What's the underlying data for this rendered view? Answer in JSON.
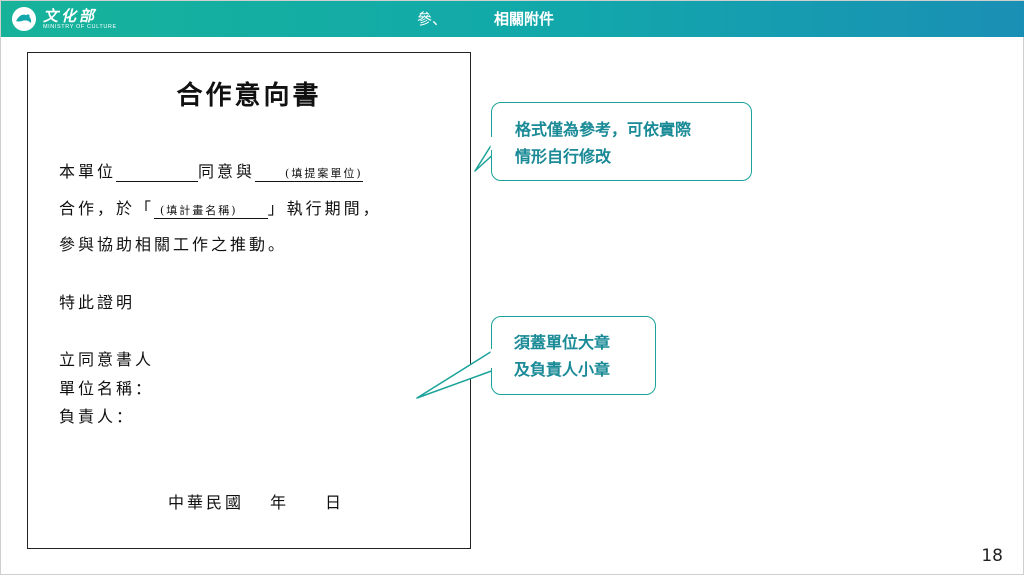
{
  "header": {
    "logo_text": "文化部",
    "logo_subtext": "MINISTRY OF CULTURE",
    "section_number": "參、",
    "section_title": "相關附件"
  },
  "document": {
    "title": "合作意向書",
    "line1_a": "本單位",
    "line1_b": "同意與",
    "line1_hint": "(填提案單位)",
    "line2_a": "合作，於「",
    "line2_hint": "(填計畫名稱)",
    "line2_b": "」執行期間，",
    "line3": "參與協助相關工作之推動。",
    "certify": "特此證明",
    "signer": "立同意書人",
    "unit_name": "單位名稱：",
    "responsible": "負責人：",
    "date_country": "中華民國",
    "date_year": "年",
    "date_day": "日"
  },
  "callouts": [
    {
      "line1": "格式僅為參考，可依實際",
      "line2": "情形自行修改"
    },
    {
      "line1": "須蓋單位大章",
      "line2": "及負責人小章"
    }
  ],
  "page_number": "18",
  "colors": {
    "header_start": "#16b39a",
    "header_end": "#1a8fb5",
    "callout": "#1aa39a"
  }
}
